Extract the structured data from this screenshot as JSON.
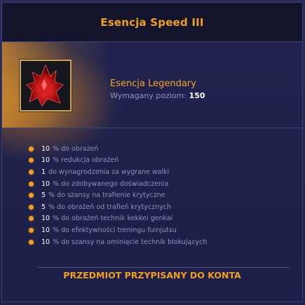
{
  "tooltip": {
    "title": "Esencja Speed III",
    "item": {
      "icon": "red-crystal-essence-icon",
      "name": "Esencja Legendary",
      "level_label": "Wymagany poziom:",
      "level_value": "150"
    },
    "stats": [
      {
        "value": "10",
        "text": "% do obrażeń"
      },
      {
        "value": "10",
        "text": "% redukcja obrażeń"
      },
      {
        "value": "1",
        "text": "do wynagrodzenia za wygrane walki"
      },
      {
        "value": "10",
        "text": "% do zdobywanego doświadczenia"
      },
      {
        "value": "5",
        "text": "% do szansy na trafienie krytyczne"
      },
      {
        "value": "5",
        "text": "% do obrażeń od trafień krytycznych"
      },
      {
        "value": "10",
        "text": "% do obrażeń technik kekkei genkai"
      },
      {
        "value": "10",
        "text": "% do efektywności treningu fuinjutsu"
      },
      {
        "value": "10",
        "text": "% do szansy na ominięcie technik blokujących"
      }
    ],
    "footer": "PRZEDMIOT PRZYPISANY DO KONTA"
  },
  "colors": {
    "accent": "#f0a020",
    "background": "#1f2148",
    "header": "#14142c",
    "stat_text": "#8d92c2"
  }
}
